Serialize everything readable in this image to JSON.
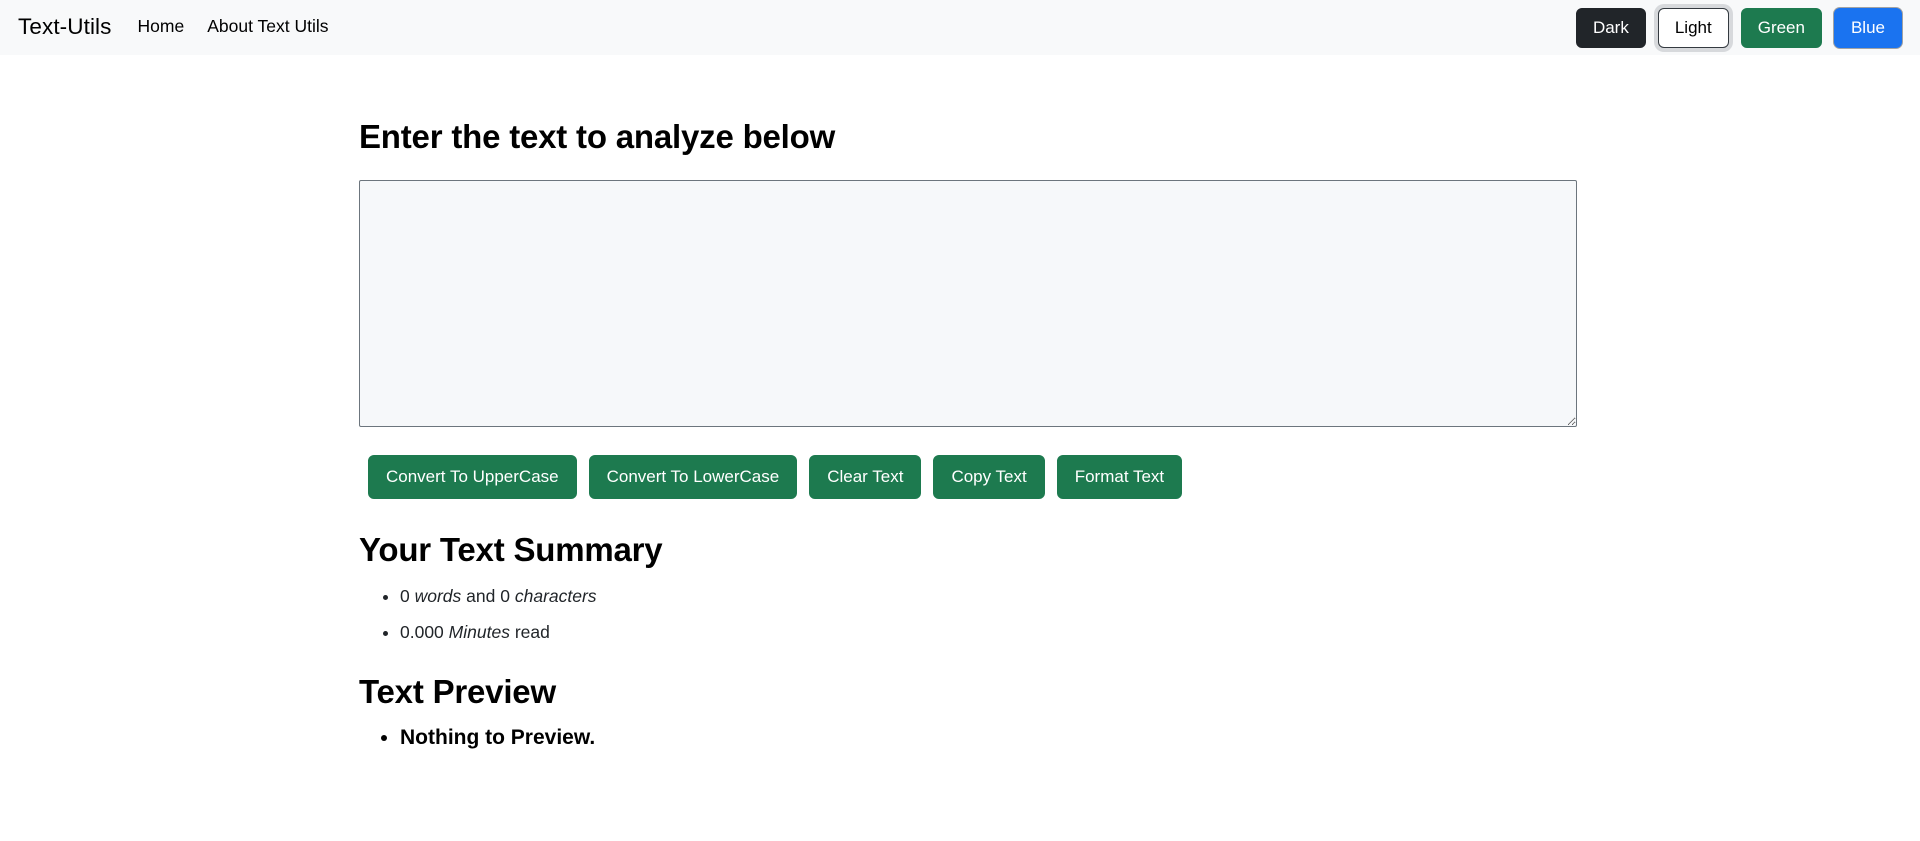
{
  "navbar": {
    "brand": "Text-Utils",
    "links": [
      {
        "label": "Home"
      },
      {
        "label": "About Text Utils"
      }
    ],
    "theme_buttons": [
      {
        "label": "Dark",
        "color": "#212529"
      },
      {
        "label": "Light",
        "color": "#ffffff"
      },
      {
        "label": "Green",
        "color": "#1d7a4f"
      },
      {
        "label": "Blue",
        "color": "#1a73f0"
      }
    ],
    "background": "#f8f9fa"
  },
  "main": {
    "heading": "Enter the text to analyze below",
    "textarea": {
      "value": "",
      "placeholder": "",
      "background": "#f6f8fa",
      "border_color": "#6c757d"
    },
    "actions": [
      {
        "label": "Convert To UpperCase"
      },
      {
        "label": "Convert To LowerCase"
      },
      {
        "label": "Clear Text"
      },
      {
        "label": "Copy Text"
      },
      {
        "label": "Format Text"
      }
    ],
    "summary": {
      "heading": "Your Text Summary",
      "word_count": "0",
      "word_unit": "words",
      "conjunction": "and",
      "char_count": "0",
      "char_unit": "characters",
      "read_time": "0.000",
      "read_unit": "Minutes",
      "read_suffix": "read"
    },
    "preview": {
      "heading": "Text Preview",
      "empty_message": "Nothing to Preview."
    }
  },
  "theme": {
    "accent_green": "#1d7a4f",
    "accent_blue": "#1a73f0",
    "page_background": "#ffffff",
    "text_color": "#212529"
  }
}
